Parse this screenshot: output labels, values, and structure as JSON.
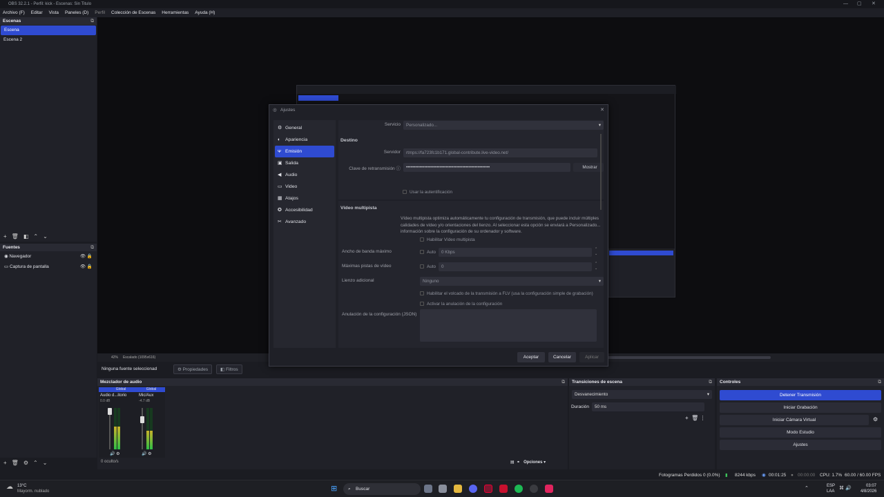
{
  "window": {
    "title": "OBS 32.2.1 - Perfil: kick - Escenas: Sin Titulo",
    "controls": [
      "—",
      "▢",
      "✕"
    ]
  },
  "menu": [
    "Archivo (F)",
    "Editar",
    "Vista",
    "Paneles (D)",
    "Perfil",
    "Colección de Escenas",
    "Herramientas",
    "Ayuda (H)"
  ],
  "scenes": {
    "title": "Escenas",
    "items": [
      "Escena",
      "Escena 2"
    ]
  },
  "sources": {
    "title": "Fuentes",
    "items": [
      "Navegador",
      "Captura de pantalla"
    ]
  },
  "preview": {
    "zoom": "42%",
    "scale": "Escalado (1095x616)"
  },
  "propbar": {
    "label": "Ninguna fuente seleccionad",
    "props": "Propiedades",
    "filters": "Filtros"
  },
  "mixer": {
    "title": "Mezclador de audio",
    "channels": [
      {
        "tag": "Global",
        "name": "Audio d...itorio",
        "db": "0.0 dB",
        "level": 0.55
      },
      {
        "tag": "Global",
        "name": "Mic/Aux",
        "db": "-4.7 dB",
        "level": 0.45
      }
    ],
    "scale": [
      "0",
      "-6",
      "-12",
      "-18",
      "-24",
      "-30",
      "-36",
      "-42",
      "-48",
      "-54",
      "-60"
    ],
    "hidden": "0 oculto/s",
    "options": "Opciones"
  },
  "transitions": {
    "title": "Transiciones de escena",
    "type": "Desvanecimiento",
    "duration_label": "Duración",
    "duration": "50 ms"
  },
  "controls": {
    "title": "Controles",
    "buttons": [
      "Detener Transmisión",
      "Iniciar Grabación",
      "Iniciar Cámara Virtual",
      "Modo Estudio",
      "Ajustes"
    ]
  },
  "status": {
    "dropped": "Fotogramas Perdidos 0 (0.0%)",
    "bitrate": "8244 kbps",
    "stream_time": "00:01:25",
    "rec_time": "00:00:00",
    "cpu": "CPU: 1.7%",
    "fps": "60.00 / 60.00 FPS"
  },
  "dialog": {
    "title": "Ajustes",
    "nav": [
      {
        "icon": "gear-icon",
        "glyph": "⚙",
        "label": "General"
      },
      {
        "icon": "palette-icon",
        "glyph": "◐",
        "label": "Apariencia"
      },
      {
        "icon": "antenna-icon",
        "glyph": "ᴪ",
        "label": "Emisión"
      },
      {
        "icon": "output-icon",
        "glyph": "▣",
        "label": "Salida"
      },
      {
        "icon": "speaker-icon",
        "glyph": "◀",
        "label": "Audio"
      },
      {
        "icon": "monitor-icon",
        "glyph": "▭",
        "label": "Video"
      },
      {
        "icon": "keyboard-icon",
        "glyph": "▦",
        "label": "Atajos"
      },
      {
        "icon": "accessibility-icon",
        "glyph": "✪",
        "label": "Accesibilidad"
      },
      {
        "icon": "wrench-icon",
        "glyph": "✂",
        "label": "Avanzado"
      }
    ],
    "service_label": "Servicio",
    "service_value": "Personalizado...",
    "dest_title": "Destino",
    "server_label": "Servidor",
    "server_value": "rtmps://fa723fc1b171.global-contribute.live-video.net/",
    "key_label": "Clave de retransmisión",
    "key_value": "•••••••••••••••••••••••••••••••••••••••••••••••••••••••",
    "show_btn": "Mostrar",
    "auth": "Usar la autentificación",
    "multi_title": "Vídeo multipista",
    "multi_desc": "Vídeo multipista optimiza automáticamente tu configuración de transmisión, que puede incluir múltiples calidades de vídeo y/o orientaciones del lienzo. Al seleccionar esta opción se enviará a Personalizado... información sobre la configuración de su ordenador y software.",
    "enable_multi": "Habilitar Vídeo multipista",
    "bw_label": "Ancho de banda máximo",
    "bw_auto": "Auto",
    "bw_value": "0 Kbps",
    "tracks_label": "Máximas pistas de vídeo",
    "tracks_auto": "Auto",
    "tracks_value": "0",
    "canvas_label": "Lienzo adicional",
    "canvas_value": "Ninguno",
    "flv": "Habilitar el volcado de la transmisión a FLV (usa la configuración simple de grabación)",
    "override_enable": "Activar la anulación de la configuración",
    "override_label": "Anulación de la configuración (JSON)",
    "ok": "Aceptar",
    "cancel": "Cancelar",
    "apply": "Aplicar"
  },
  "taskbar": {
    "weather_temp": "13°C",
    "weather_desc": "Mayorm. nublado",
    "search": "Buscar",
    "lang1": "ESP",
    "lang2": "LAA",
    "time": "03:07",
    "date": "4/8/2026"
  }
}
